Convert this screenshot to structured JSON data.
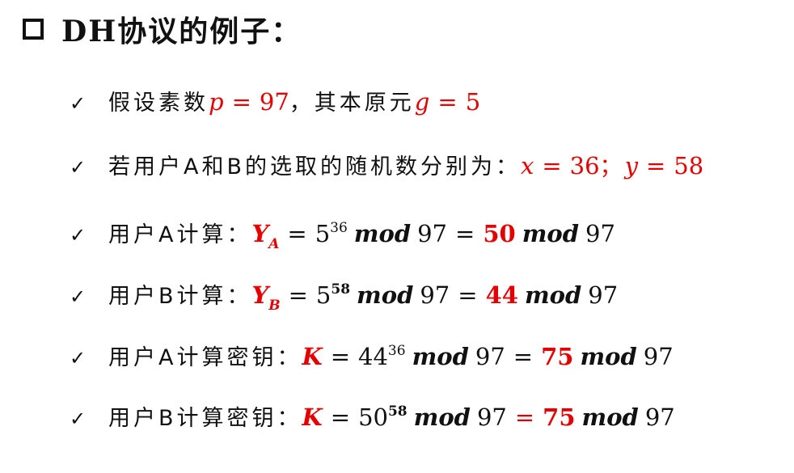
{
  "title": "DH协议的例子：",
  "lines": {
    "l1": {
      "text": "假设素数 ",
      "p_var": "p",
      "eq": "=",
      "p_val": "97",
      "mid": "，其本原元 ",
      "g_var": "g",
      "g_val": "5"
    },
    "l2": {
      "text": "若用户A和B的选取的随机数分别为：",
      "x_var": "x",
      "eq": "=",
      "x_val": "36",
      "sep": "；",
      "y_var": "y",
      "y_val": "58"
    },
    "l3": {
      "text": "用户A计算：",
      "lhs": "Y",
      "sub": "A",
      "eq": "=",
      "base": "5",
      "exp": "36",
      "mod": "mod",
      "modulus": "97",
      "result": "50"
    },
    "l4": {
      "text": "用户B计算：",
      "lhs": "Y",
      "sub": "B",
      "eq": "=",
      "base": "5",
      "exp": "58",
      "mod": "mod",
      "modulus": "97",
      "result": "44"
    },
    "l5": {
      "text": "用户A计算密钥：",
      "lhs": "K",
      "eq": "=",
      "base": "44",
      "exp": "36",
      "mod": "mod",
      "modulus": "97",
      "result": "75"
    },
    "l6": {
      "text": "用户B计算密钥：",
      "lhs": "K",
      "eq": "=",
      "base": "50",
      "exp": "58",
      "mod": "mod",
      "modulus": "97",
      "result": "75"
    }
  },
  "icons": {
    "title": "square-bullet-icon",
    "items": "checkmark-icon"
  },
  "colors": {
    "accent": "#e60000",
    "text": "#111111"
  }
}
